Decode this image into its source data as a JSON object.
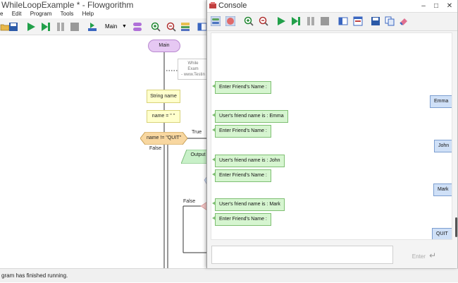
{
  "main_window": {
    "title": "WhileLoopExample * - Flowgorithm",
    "menu": [
      "e",
      "Edit",
      "Program",
      "Tools",
      "Help"
    ],
    "toolbar": {
      "function_select": "Main"
    },
    "status": "gram has finished running."
  },
  "flowchart": {
    "start_label": "Main",
    "comment_lines": [
      "While",
      "Exam",
      "- www.Testin"
    ],
    "declare_label": "String name",
    "assign_label": "name = \" \"",
    "while_label": "name != \"QUIT\"",
    "true_label": "True",
    "false_label": "False",
    "output_label": "Output",
    "false_label_2": "False"
  },
  "console": {
    "title": "Console",
    "enter_label": "Enter",
    "input_value": "",
    "messages": [
      {
        "type": "output",
        "text": "Enter Friend's Name :"
      },
      {
        "type": "input",
        "text": "Emma"
      },
      {
        "type": "output",
        "text": "User's friend name is : Emma"
      },
      {
        "type": "output",
        "text": "Enter Friend's Name :"
      },
      {
        "type": "input",
        "text": "John"
      },
      {
        "type": "output",
        "text": "User's friend name is : John"
      },
      {
        "type": "output",
        "text": "Enter Friend's Name :"
      },
      {
        "type": "input",
        "text": "Mark"
      },
      {
        "type": "output",
        "text": "User's friend name is : Mark"
      },
      {
        "type": "output",
        "text": "Enter Friend's Name :"
      },
      {
        "type": "input",
        "text": "QUIT"
      }
    ]
  },
  "colors": {
    "output_bubble": "#d6f5d0",
    "input_bubble": "#cfe0f7",
    "start_shape": "#e6c8f3",
    "process_shape": "#ffffcc",
    "decision_shape": "#f8d7a0",
    "output_shape": "#c8f0c8"
  }
}
